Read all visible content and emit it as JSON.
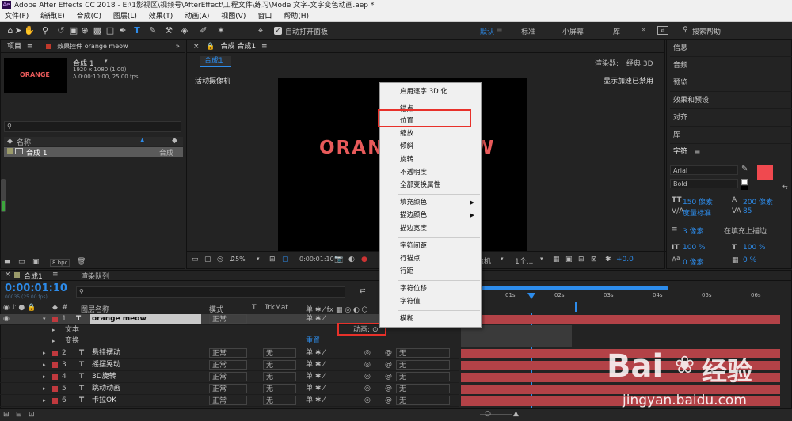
{
  "window": {
    "app_logo": "Ae",
    "title": "Adobe After Effects CC 2018 - E:\\1影视区\\视频号\\AfterEffect\\工程文件\\练习\\Mode 文字-文字变色动画.aep *"
  },
  "menu": [
    "文件(F)",
    "编辑(E)",
    "合成(C)",
    "图层(L)",
    "效果(T)",
    "动画(A)",
    "视图(V)",
    "窗口",
    "帮助(H)"
  ],
  "toolbar": {
    "auto_open_panel": "自动打开面板",
    "workspaces": [
      "默认",
      "标准",
      "小屏幕",
      "库"
    ],
    "search_help": "搜索帮助"
  },
  "project_panel": {
    "tab_project": "项目",
    "tab_effects": "效果控件 orange meow",
    "thumbnail_text": "ORANGE",
    "comp_name": "合成 1",
    "comp_info_1": "1920 x 1080 (1.00)",
    "comp_info_2": "Δ 0:00:10:00, 25.00 fps",
    "col_name": "名称",
    "item_name": "合成 1",
    "item_type": "合成",
    "bpc": "8 bpc"
  },
  "comp_panel": {
    "tab_label": "合成 合成1",
    "sub_tab": "合成1",
    "renderer_label": "渲染器:",
    "renderer_value": "经典 3D",
    "camera": "活动摄像机",
    "gpu_notice": "显示加速已禁用",
    "canvas_text": "ORANGE MEOW",
    "zoom": "25%",
    "time": "0:00:01:10",
    "camera_dd": "像机",
    "views_dd": "1个...",
    "exposure": "+0.0"
  },
  "context_menu": {
    "items": [
      {
        "label": "启用逐字 3D 化"
      },
      {
        "label": "锚点"
      },
      {
        "label": "位置",
        "highlighted": true
      },
      {
        "label": "缩放"
      },
      {
        "label": "倾斜"
      },
      {
        "label": "旋转"
      },
      {
        "label": "不透明度"
      },
      {
        "label": "全部变换属性"
      },
      {
        "label": "填充颜色",
        "submenu": true
      },
      {
        "label": "描边颜色",
        "submenu": true
      },
      {
        "label": "描边宽度"
      },
      {
        "label": "字符间距"
      },
      {
        "label": "行锚点"
      },
      {
        "label": "行距"
      },
      {
        "label": "字符位移"
      },
      {
        "label": "字符值"
      },
      {
        "label": "模糊"
      }
    ]
  },
  "right_panel": {
    "items": [
      "信息",
      "音频",
      "预览",
      "效果和预设",
      "对齐",
      "库"
    ],
    "character_title": "字符",
    "font_family": "Arial",
    "font_style": "Bold",
    "font_size": "150 像素",
    "leading": "200 像素",
    "kerning": "度量标准",
    "tracking": "85",
    "stroke_width": "3 像素",
    "stroke_mode": "在填充上描边",
    "vscale": "100 %",
    "hscale": "100 %",
    "baseline": "0 像素",
    "tsume": "0 %",
    "fill_color": "#f0494f"
  },
  "timeline": {
    "tab_comp": "合成1",
    "tab_render": "渲染队列",
    "timecode": "0:00:01:10",
    "timecode_sub": "00035 (25.00 fps)",
    "col_layer_name": "图层名称",
    "col_mode": "模式",
    "col_t": "T",
    "col_trkmat": "TrkMat",
    "col_parent": "父级",
    "animate_label": "动画:",
    "reset_label": "重置",
    "ruler_labels": [
      "01s",
      "02s",
      "03s",
      "04s",
      "05s",
      "06s"
    ],
    "layers": [
      {
        "num": "1",
        "name": "orange meow",
        "mode": "正常",
        "trkmat": "",
        "parent": "",
        "selected": true
      },
      {
        "num": "",
        "name": "文本",
        "mode": "",
        "trkmat": "",
        "parent": "",
        "child": true
      },
      {
        "num": "",
        "name": "变换",
        "mode": "",
        "trkmat": "",
        "parent": "",
        "child": true
      },
      {
        "num": "2",
        "name": "悬挂摆动",
        "mode": "正常",
        "trkmat": "无",
        "parent": "无"
      },
      {
        "num": "3",
        "name": "摇摆晃动",
        "mode": "正常",
        "trkmat": "无",
        "parent": "无"
      },
      {
        "num": "4",
        "name": "3D旋转",
        "mode": "正常",
        "trkmat": "无",
        "parent": "无"
      },
      {
        "num": "5",
        "name": "跳动动画",
        "mode": "正常",
        "trkmat": "无",
        "parent": "无"
      },
      {
        "num": "6",
        "name": "卡拉OK",
        "mode": "正常",
        "trkmat": "无",
        "parent": "无"
      }
    ]
  },
  "watermark": {
    "brand": "Bai",
    "brand2": "经验",
    "url": "jingyan.baidu.com"
  }
}
